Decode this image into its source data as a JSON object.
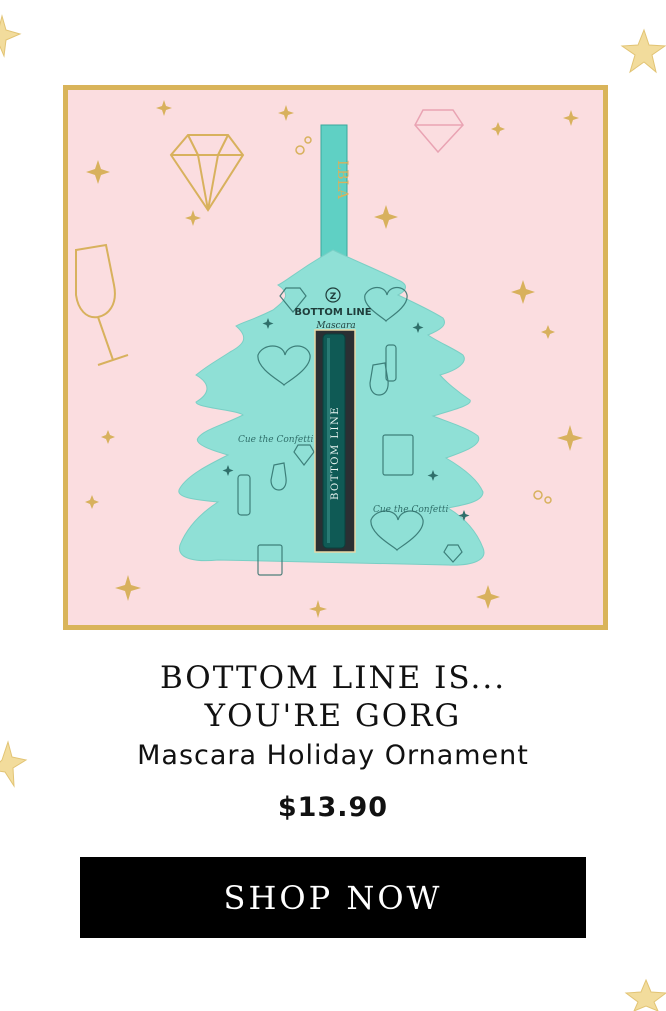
{
  "product": {
    "headline_line1": "BOTTOM LINE IS...",
    "headline_line2": "YOU'RE GORG",
    "name": "Mascara Holiday Ornament",
    "price": "$13.90"
  },
  "cta": {
    "label": "SHOP NOW"
  },
  "packaging": {
    "brand_ribbon": "LBLA",
    "package_title": "BOTTOM LINE",
    "package_script": "Mascara",
    "tube_text": "BOTTOM LINE",
    "script_left": "Cue the Confetti",
    "script_right": "Cue the Confetti"
  },
  "colors": {
    "accent_gold": "#d9b45a",
    "background_pink": "#fbdde0",
    "ornament_teal": "#8fe0d6",
    "button_black": "#000000"
  }
}
